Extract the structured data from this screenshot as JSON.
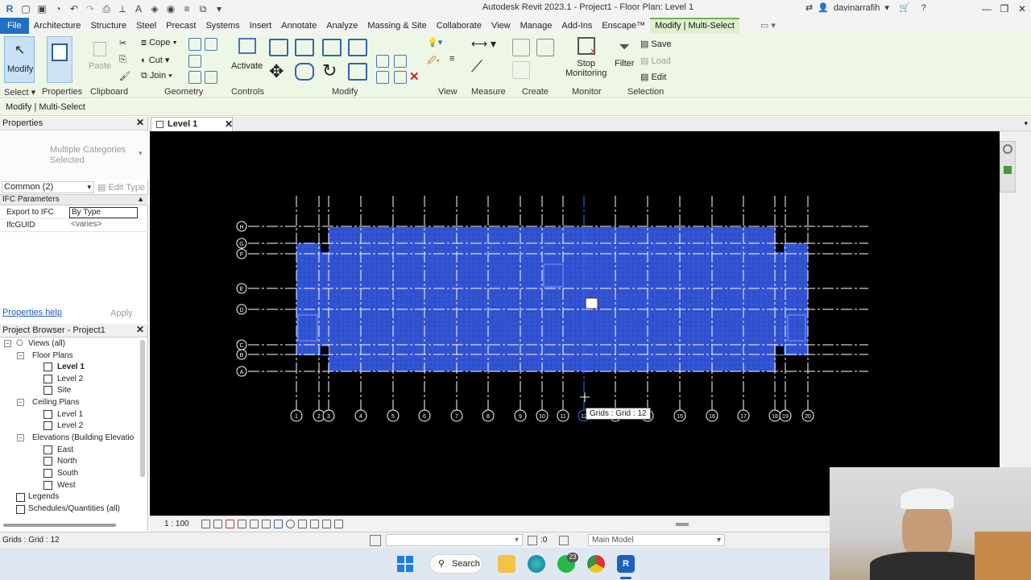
{
  "window": {
    "title": "Autodesk Revit 2023.1 - Project1 - Floor Plan: Level 1",
    "user": "davinarrafih"
  },
  "tabs": [
    "File",
    "Architecture",
    "Structure",
    "Steel",
    "Precast",
    "Systems",
    "Insert",
    "Annotate",
    "Analyze",
    "Massing & Site",
    "Collaborate",
    "View",
    "Manage",
    "Add-Ins",
    "Enscape™",
    "Modify | Multi-Select"
  ],
  "ribbon": {
    "modify_label": "Modify",
    "paste_label": "Paste",
    "cope_label": "Cope",
    "cut_label": "Cut",
    "join_label": "Join",
    "activate_label": "Activate",
    "stop_label_1": "Stop",
    "stop_label_2": "Monitoring",
    "filter_label": "Filter",
    "save_label": "Save",
    "load_label": "Load",
    "edit_label": "Edit",
    "panels": {
      "select": "Select",
      "properties": "Properties",
      "clipboard": "Clipboard",
      "geometry": "Geometry",
      "controls": "Controls",
      "modify": "Modify",
      "view": "View",
      "measure": "Measure",
      "create": "Create",
      "monitor": "Monitor",
      "selection": "Selection"
    }
  },
  "context_bar": "Modify | Multi-Select",
  "properties": {
    "title": "Properties",
    "type_selector": "Multiple Categories Selected",
    "filter": "Common (2)",
    "edit_type": "Edit Type",
    "group": "IFC Parameters",
    "rows": [
      {
        "key": "Export to IFC",
        "value": "By Type"
      },
      {
        "key": "IfcGUID",
        "value": "<varies>"
      }
    ],
    "help": "Properties help",
    "apply": "Apply"
  },
  "browser": {
    "title": "Project Browser - Project1",
    "views_all": "Views (all)",
    "floor_plans": "Floor Plans",
    "fp_items": [
      "Level 1",
      "Level 2",
      "Site"
    ],
    "ceiling_plans": "Ceiling Plans",
    "cp_items": [
      "Level 1",
      "Level 2"
    ],
    "elevations": "Elevations (Building Elevatio",
    "el_items": [
      "East",
      "North",
      "South",
      "West"
    ],
    "legends": "Legends",
    "schedules": "Schedules/Quantities (all)"
  },
  "view_tab": "Level 1",
  "grid": {
    "vertical_labels": [
      "1",
      "2",
      "3",
      "4",
      "5",
      "6",
      "7",
      "8",
      "9",
      "10",
      "11",
      "12",
      "13",
      "14",
      "15",
      "16",
      "17",
      "18",
      "19",
      "20"
    ],
    "horizontal_labels": [
      "H",
      "G",
      "F",
      "E",
      "D",
      "C",
      "B",
      "A"
    ]
  },
  "tooltip": "Grids : Grid : 12",
  "view_control": {
    "scale": "1 : 100"
  },
  "status": {
    "text": "Grids : Grid : 12",
    "zero": ":0",
    "model": "Main Model"
  },
  "taskbar": {
    "search": "Search",
    "whatsapp_badge": "23"
  },
  "colors": {
    "accent": "#1f6fc2",
    "ribbon": "#eef7e6",
    "selection_blue": "#3355d6",
    "canvas": "#000000"
  }
}
